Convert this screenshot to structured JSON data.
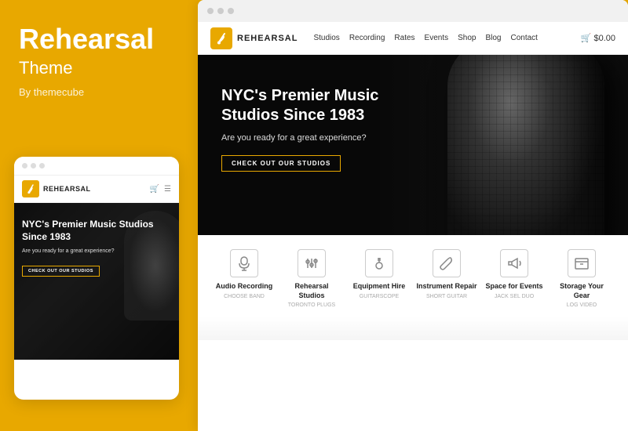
{
  "left_panel": {
    "title": "Rehearsal",
    "subtitle": "Theme",
    "author": "By themecube"
  },
  "mobile_preview": {
    "dots": [
      "dot1",
      "dot2",
      "dot3"
    ],
    "logo_text": "REHEARSAL",
    "hero_title": "NYC's Premier Music Studios Since 1983",
    "hero_subtitle": "Are you ready for a great experience?",
    "hero_button": "CHECK OUT OUR STUDIOS"
  },
  "browser": {
    "dots": [
      "dot1",
      "dot2",
      "dot3"
    ],
    "nav": {
      "logo_text": "REHEARSAL",
      "links": [
        "Studios",
        "Recording",
        "Rates",
        "Events",
        "Shop",
        "Blog",
        "Contact"
      ],
      "cart": "$0.00"
    },
    "hero": {
      "title": "NYC's Premier Music Studios Since 1983",
      "subtitle": "Are you ready for a great experience?",
      "button": "CHECK OUT OUR STUDIOS"
    },
    "services": [
      {
        "title": "Audio Recording",
        "desc": "CHOOSE BAND",
        "icon": "🎙"
      },
      {
        "title": "Rehearsal Studios",
        "desc": "TORONTO PLUGS",
        "icon": "🎛"
      },
      {
        "title": "Equipment Hire",
        "desc": "GUITARSCOPE",
        "icon": "🎸"
      },
      {
        "title": "Instrument Repair",
        "desc": "SHORT GUITAR",
        "icon": "🔧"
      },
      {
        "title": "Space for Events",
        "desc": "JACK SEL DUO",
        "icon": "📢"
      },
      {
        "title": "Storage Your Gear",
        "desc": "LOG VIDEO",
        "icon": "🗄"
      }
    ]
  },
  "colors": {
    "accent": "#e8a800",
    "dark": "#1a1a1a",
    "text": "#222222",
    "muted": "#aaaaaa"
  }
}
